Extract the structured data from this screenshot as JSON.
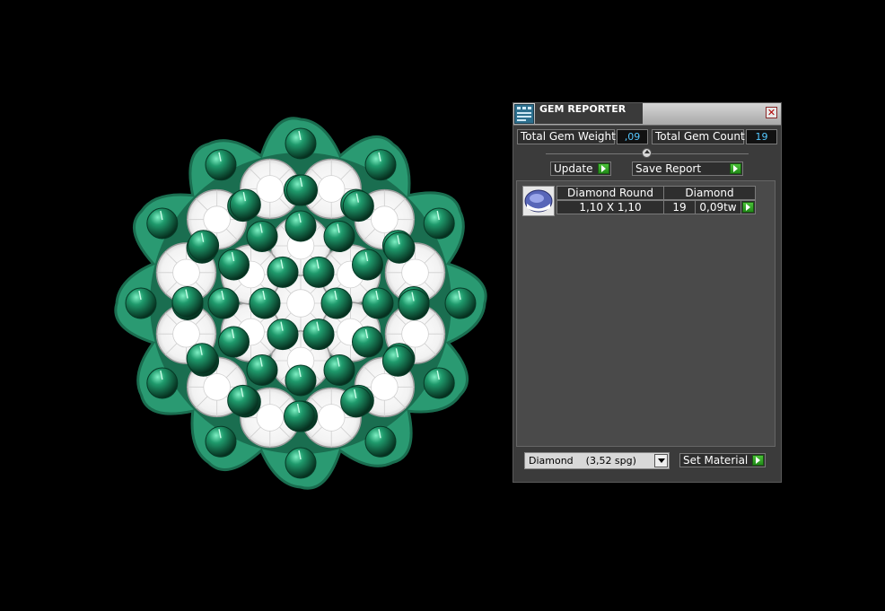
{
  "colors": {
    "background": "#000000",
    "metal": "#2a9a72",
    "metal_dark": "#1a6e50",
    "stone": "#ffffff",
    "emerald": "#1c7a58",
    "accent_value": "#55c8ff",
    "arrow_green": "#2ea822"
  },
  "gem_reporter": {
    "title": "GEM REPORTER",
    "close_glyph": "✕",
    "total_weight_label": "Total Gem Weight",
    "total_weight_value": ",09",
    "total_count_label": "Total Gem Count",
    "total_count_value": "19",
    "update_label": "Update",
    "save_report_label": "Save Report",
    "table": {
      "header_shape": "Diamond Round",
      "header_material": "Diamond",
      "rows": [
        {
          "size": "1,10 X 1,10",
          "count": "19",
          "weight": "0,09tw"
        }
      ]
    },
    "material_select": "Diamond    (3,52 spg)",
    "set_material_label": "Set Material"
  }
}
